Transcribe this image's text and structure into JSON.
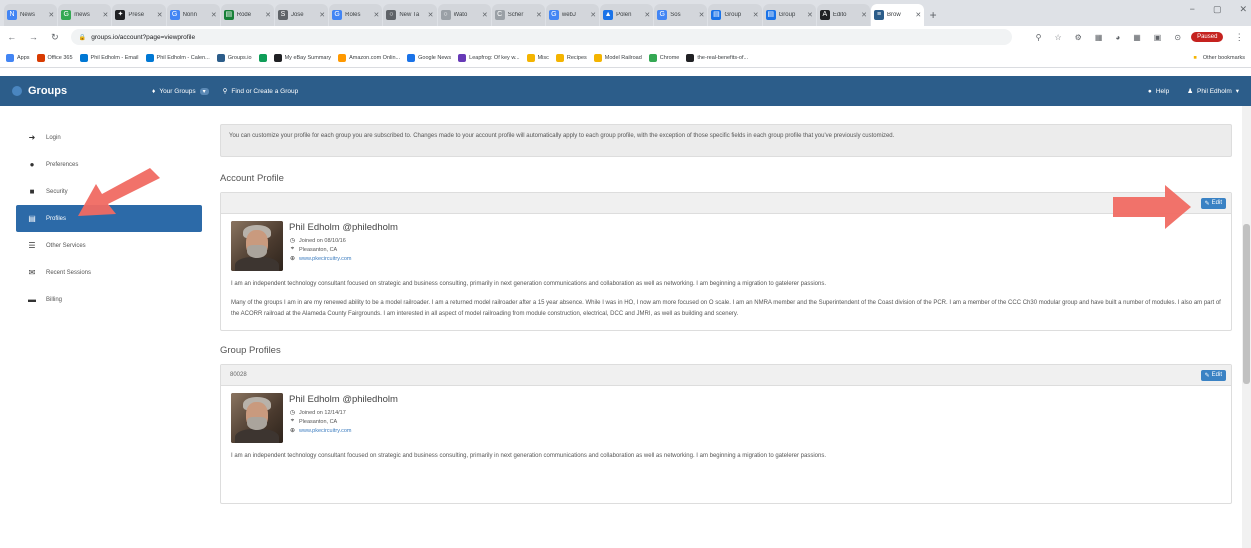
{
  "browser": {
    "tabs": [
      {
        "label": "News",
        "color": "#4285f4",
        "glyph": "N"
      },
      {
        "label": "mews",
        "color": "#34a853",
        "glyph": "G"
      },
      {
        "label": "Prese",
        "color": "#202124",
        "glyph": "✦"
      },
      {
        "label": "Nonn",
        "color": "#4285f4",
        "glyph": "G"
      },
      {
        "label": "Rode",
        "color": "#188038",
        "glyph": "▤"
      },
      {
        "label": "Jose",
        "color": "#5f6368",
        "glyph": "S"
      },
      {
        "label": "Roles",
        "color": "#4285f4",
        "glyph": "G"
      },
      {
        "label": "New Ta",
        "color": "#5f6368",
        "glyph": "○"
      },
      {
        "label": "Wato",
        "color": "#9aa0a6",
        "glyph": "○"
      },
      {
        "label": "Scher",
        "color": "#9aa0a6",
        "glyph": "C"
      },
      {
        "label": "webJ",
        "color": "#4285f4",
        "glyph": "G"
      },
      {
        "label": "Polen",
        "color": "#1a73e8",
        "glyph": "▲"
      },
      {
        "label": "Sos",
        "color": "#4285f4",
        "glyph": "G"
      },
      {
        "label": "Group",
        "color": "#1a73e8",
        "glyph": "▤"
      },
      {
        "label": "Group",
        "color": "#1a73e8",
        "glyph": "▤"
      },
      {
        "label": "Edito",
        "color": "#202124",
        "glyph": "A"
      },
      {
        "label": "Brow",
        "color": "#2c5d8a",
        "glyph": "≡",
        "active": true
      }
    ],
    "new_tab": "+",
    "window_controls": [
      "−",
      "▢",
      "✕"
    ],
    "nav": {
      "back": "←",
      "forward": "→",
      "reload": "↻"
    },
    "url": "groups.io/account?page=viewprofile",
    "lock": "🔒",
    "extensions": [
      "⚲",
      "☆",
      "⚙",
      "▦",
      "◕",
      "▦",
      "▣",
      "⊙"
    ],
    "paused_label": "Paused",
    "menu": "⋮",
    "bookmarks": [
      {
        "label": "Apps",
        "color": "#4285f4"
      },
      {
        "label": "Office 365",
        "color": "#d83b01"
      },
      {
        "label": "Phil Edholm - Email",
        "color": "#0078d4"
      },
      {
        "label": "Phil Edholm - Calen...",
        "color": "#0078d4"
      },
      {
        "label": "Groups.io",
        "color": "#2c5d8a"
      },
      {
        "label": "",
        "color": "#0f9d58"
      },
      {
        "label": "My eBay Summary",
        "color": "#202124"
      },
      {
        "label": "Amazon.com Onlin...",
        "color": "#ff9900"
      },
      {
        "label": "Google News",
        "color": "#1a73e8"
      },
      {
        "label": "Leapfrog: Of key w...",
        "color": "#673ab7"
      },
      {
        "label": "Misc",
        "color": "#f4b400"
      },
      {
        "label": "Recipes",
        "color": "#f4b400"
      },
      {
        "label": "Model Railroad",
        "color": "#f4b400"
      },
      {
        "label": "Chrome",
        "color": "#34a853"
      },
      {
        "label": "the-real-benefits-of...",
        "color": "#202124"
      }
    ],
    "other_bookmarks": "Other bookmarks"
  },
  "site": {
    "brand": "Groups",
    "nav": {
      "your_groups": "Your Groups",
      "your_groups_badge": "▾",
      "find_create": "Find or Create a Group",
      "help": "Help",
      "user": "Phil Edholm"
    }
  },
  "sidebar": {
    "items": [
      {
        "label": "Login",
        "icon": "➜",
        "name": "login"
      },
      {
        "label": "Preferences",
        "icon": "●",
        "name": "preferences"
      },
      {
        "label": "Security",
        "icon": "■",
        "name": "security"
      },
      {
        "label": "Profiles",
        "icon": "▤",
        "name": "profiles",
        "active": true
      },
      {
        "label": "Other Services",
        "icon": "☰",
        "name": "other-services"
      },
      {
        "label": "Recent Sessions",
        "icon": "✉",
        "name": "recent-sessions"
      },
      {
        "label": "Billing",
        "icon": "▬",
        "name": "billing"
      }
    ]
  },
  "main": {
    "notice": "You can customize your profile for each group you are subscribed to. Changes made to your account profile will automatically apply to each group profile, with the exception of those specific fields in each group profile that you've previously customized.",
    "account_profile_title": "Account Profile",
    "group_profiles_title": "Group Profiles",
    "edit_label": "Edit",
    "account_profile": {
      "panel_header": "",
      "name": "Phil Edholm @philedholm",
      "joined": "Joined on 08/10/16",
      "location": "Pleasanton, CA",
      "website": "www.pkecircuitry.com",
      "bio": [
        "I am an independent technology consultant focused on strategic and business consulting, primarily in next generation communications and collaboration as well as networking. I am beginning a migration to gatelerer passions.",
        "Many of the groups I am in are my renewed ability to be a model railroader. I am a returned model railroader after a 15 year absence. While I was in HO, I now am more focused on O scale. I am an NMRA member and the Superintendent of the Coast division of the PCR. I am a member of the CCC Ch30 modular group and have built a number of modules. I also am part of the ACORR railroad at the Alameda County Fairgrounds. I am interested in all aspect of model railroading from module construction, electrical, DCC and JMRI, as well as building and scenery."
      ]
    },
    "group_profile": {
      "panel_header": "80028",
      "name": "Phil Edholm @philedholm",
      "joined": "Joined on 12/14/17",
      "location": "Pleasanton, CA",
      "website": "www.pkecircuitry.com",
      "bio": [
        "I am an independent technology consultant focused on strategic and business consulting, primarily in next generation communications and collaboration as well as networking. I am beginning a migration to gatelerer passions."
      ]
    },
    "icons": {
      "joined": "◷",
      "location": "⌖",
      "website": "⊕",
      "edit": "✎"
    }
  },
  "annotation_color": "#f06a62"
}
